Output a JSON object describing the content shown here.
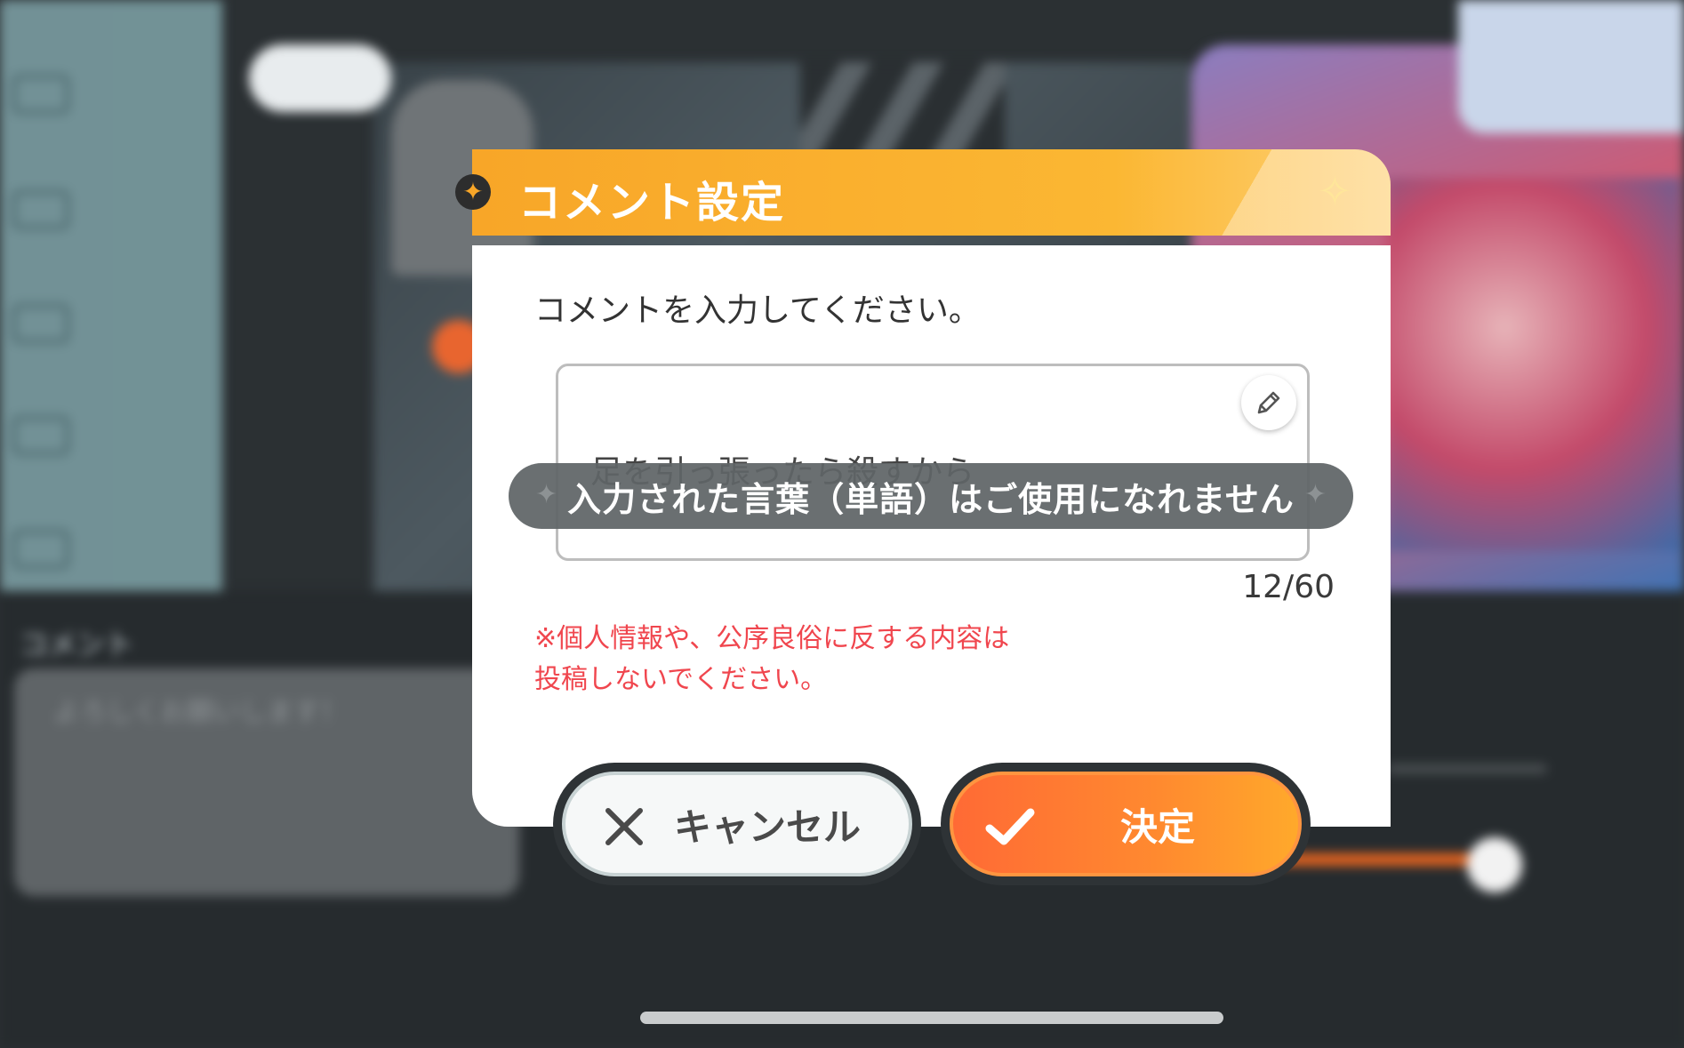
{
  "background": {
    "comment_label": "コメント",
    "comment_text": "よろしくお願いします！"
  },
  "dialog": {
    "title": "コメント設定",
    "prompt": "コメントを入力してください。",
    "input_value": "足を引っ張ったら殺すから",
    "counter": "12/60",
    "warning_line1": "※個人情報や、公序良俗に反する内容は",
    "warning_line2": "投稿しないでください。"
  },
  "toast": {
    "message": "入力された言葉（単語）はご使用になれません"
  },
  "buttons": {
    "cancel_label": "キャンセル",
    "ok_label": "決定"
  },
  "colors": {
    "header_orange": "#f8a628",
    "warning_red": "#f0464e",
    "ok_orange": "#ff7a33",
    "toast_gray": "#5f6466"
  },
  "icons": {
    "title_star": "star-icon",
    "header_sparkle": "sparkle-icon",
    "edit": "pencil-icon",
    "cancel": "close-icon",
    "ok": "check-icon"
  }
}
